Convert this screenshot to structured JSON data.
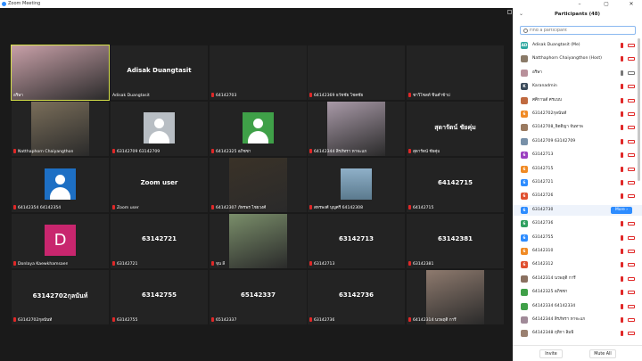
{
  "window": {
    "title": "Zoom Meeting",
    "controls": [
      "–",
      "▢",
      "✕"
    ]
  },
  "gallery": {
    "tiles": [
      {
        "big": "",
        "caption": "อริษา",
        "kind": "video",
        "color": "#c8a0a8",
        "active": true,
        "mic": false
      },
      {
        "big": "Adisak Duangtasit",
        "caption": "Adisak Duangtasit",
        "kind": "name",
        "mic": false
      },
      {
        "big": "",
        "caption": "64142703",
        "kind": "blank",
        "mic": true
      },
      {
        "big": "",
        "caption": "64142369 ธวัชชัย โชคชัย",
        "kind": "blank",
        "mic": true
      },
      {
        "big": "",
        "caption": "ชาวิโซลท์ ชิ้นคำข้าป",
        "kind": "blank",
        "mic": true
      },
      {
        "big": "",
        "caption": "Natthaphorn Chaiyangthon",
        "kind": "video",
        "color": "#7a6e5a",
        "mic": true
      },
      {
        "big": "",
        "caption": "63142709 63142709",
        "kind": "avatar",
        "avatarBg": "#b8bec4",
        "mic": true
      },
      {
        "big": "",
        "caption": "64142325 อภิชชา",
        "kind": "avatar",
        "avatarBg": "#3fa048",
        "mic": true
      },
      {
        "big": "",
        "caption": "64142344 สิรภัทรา หาจะแก",
        "kind": "video",
        "color": "#a99aa8",
        "mic": true
      },
      {
        "big": "สุดารัตน์ ชัยคุ่ม",
        "caption": "สุดารัตน์ ชัยคุ่ม",
        "kind": "name",
        "mic": true
      },
      {
        "big": "",
        "caption": "64142354 64142354",
        "kind": "avatar",
        "avatarBg": "#1d6fc4",
        "mic": true
      },
      {
        "big": "Zoom user",
        "caption": "Zoom user",
        "kind": "name",
        "mic": true
      },
      {
        "big": "",
        "caption": "64142307 ภัทรพร ไชยวงศ์",
        "kind": "video",
        "color": "#3a3228",
        "mic": true
      },
      {
        "big": "",
        "caption": "สหรพงศ์ บุญศรี 64142308",
        "kind": "video-small",
        "color": "#5b7a8e",
        "mic": true
      },
      {
        "big": "64142715",
        "caption": "64142715",
        "kind": "name",
        "mic": true
      },
      {
        "big": "",
        "caption": "Donlaya Kaewkhamsaen",
        "kind": "letter",
        "letter": "D",
        "avatarBg": "#c8266e",
        "mic": true
      },
      {
        "big": "63142721",
        "caption": "63142721",
        "kind": "name",
        "mic": true
      },
      {
        "big": "",
        "caption": "จุน ลี",
        "kind": "video",
        "color": "#7a8e6a",
        "mic": true
      },
      {
        "big": "63142713",
        "caption": "63142713",
        "kind": "name",
        "mic": true
      },
      {
        "big": "63142381",
        "caption": "63142381",
        "kind": "name",
        "mic": true
      },
      {
        "big": "63142702กุลนันท์",
        "caption": "63142702กุลนันท์",
        "kind": "name",
        "mic": true
      },
      {
        "big": "63142755",
        "caption": "63142755",
        "kind": "name",
        "mic": true
      },
      {
        "big": "65142337",
        "caption": "65142337",
        "kind": "name",
        "mic": true
      },
      {
        "big": "63142736",
        "caption": "63142736",
        "kind": "name",
        "mic": true
      },
      {
        "big": "",
        "caption": "64142314 นวพฤติ การี",
        "kind": "video",
        "color": "#8e7a6e",
        "mic": true
      }
    ]
  },
  "panel": {
    "title": "Participants (48)",
    "collapse_icon": "⌄",
    "search_placeholder": "Find a participant",
    "more_label": "More ›",
    "invite_label": "Invite",
    "mute_all_label": "Mute All",
    "participants": [
      {
        "name": "Adisak Duangtasit (Me)",
        "initials": "AD",
        "bg": "#2fa8a0",
        "mic": "muted",
        "cam": "off"
      },
      {
        "name": "Natthaphorn Chaiyangthon (Host)",
        "initials": "",
        "bg": "#8a7a68",
        "mic": "muted",
        "cam": "off"
      },
      {
        "name": "อริษา",
        "initials": "",
        "bg": "#b8909a",
        "mic": "on",
        "cam": "on"
      },
      {
        "name": "Karanadmin",
        "initials": "K",
        "bg": "#3a4a5a",
        "mic": "muted",
        "cam": "off"
      },
      {
        "name": "ศศิกานต์ ศรแบบ",
        "initials": "",
        "bg": "#c06a40",
        "mic": "muted",
        "cam": "off"
      },
      {
        "name": "63142702กุลนันท์",
        "initials": "6",
        "bg": "#f08a24",
        "mic": "muted",
        "cam": "off"
      },
      {
        "name": "63142708_จิตติญา จันทาพ",
        "initials": "",
        "bg": "#9a7a60",
        "mic": "muted",
        "cam": "off"
      },
      {
        "name": "63142709 63142709",
        "initials": "",
        "bg": "#7890a8",
        "mic": "muted",
        "cam": "off"
      },
      {
        "name": "63142713",
        "initials": "6",
        "bg": "#9b3fc0",
        "mic": "muted",
        "cam": "off"
      },
      {
        "name": "63142715",
        "initials": "6",
        "bg": "#f08a24",
        "mic": "muted",
        "cam": "off"
      },
      {
        "name": "63142721",
        "initials": "6",
        "bg": "#2d8cff",
        "mic": "muted",
        "cam": "off"
      },
      {
        "name": "63142726",
        "initials": "6",
        "bg": "#e05030",
        "mic": "muted",
        "cam": "off"
      },
      {
        "name": "63142730",
        "initials": "6",
        "bg": "#2d8cff",
        "mic": "muted",
        "cam": "off",
        "hover": true
      },
      {
        "name": "63142736",
        "initials": "6",
        "bg": "#2fa060",
        "mic": "muted",
        "cam": "off"
      },
      {
        "name": "63142755",
        "initials": "6",
        "bg": "#2d8cff",
        "mic": "muted",
        "cam": "off"
      },
      {
        "name": "64142310",
        "initials": "6",
        "bg": "#f08a24",
        "mic": "muted",
        "cam": "off"
      },
      {
        "name": "64142312",
        "initials": "6",
        "bg": "#e05030",
        "mic": "muted",
        "cam": "off"
      },
      {
        "name": "64142314 นวพฤติ การี",
        "initials": "",
        "bg": "#8a7060",
        "mic": "muted",
        "cam": "off"
      },
      {
        "name": "64142325 อภิชชา",
        "initials": "",
        "bg": "#3fa048",
        "mic": "muted",
        "cam": "off"
      },
      {
        "name": "64142334 64142334",
        "initials": "",
        "bg": "#3fa048",
        "mic": "muted",
        "cam": "off"
      },
      {
        "name": "64142344 สิรภัทรา หาจะแก",
        "initials": "",
        "bg": "#a08a98",
        "mic": "muted",
        "cam": "off"
      },
      {
        "name": "64142348 ฤทิกา ลิมพิ",
        "initials": "",
        "bg": "#9a8070",
        "mic": "muted",
        "cam": "off"
      }
    ]
  },
  "colors": {
    "accent": "#2d8cff",
    "muted_red": "#e02828",
    "active_speaker": "#d5e04a"
  }
}
